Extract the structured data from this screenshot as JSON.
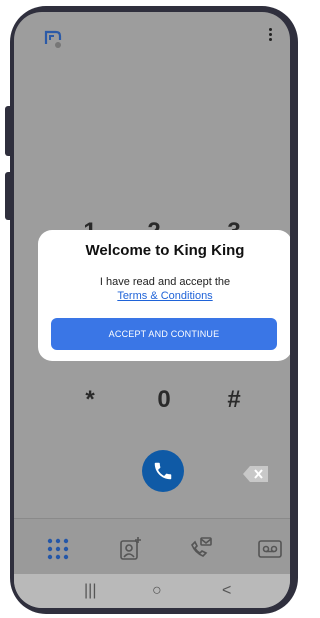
{
  "dialog": {
    "title": "Welcome to King King",
    "text": "I have read and accept the",
    "link": "Terms & Conditions",
    "accept_label": "ACCEPT AND CONTINUE"
  },
  "dialpad": {
    "top_row_partial": [
      "1",
      "2",
      "3"
    ],
    "bottom_row": [
      "*",
      "0",
      "#"
    ]
  },
  "bottom_nav": {
    "items": [
      "dialpad-grid-icon",
      "contacts-add-icon",
      "call-history-icon",
      "voicemail-icon"
    ],
    "active": "dialpad-grid-icon"
  },
  "system_nav": {
    "recents": "|||",
    "home": "○",
    "back": "<"
  },
  "colors": {
    "accent": "#3a76e6",
    "call_button": "#0f5aa6",
    "link": "#1f63d8",
    "overlay": "#9d9d9d"
  }
}
